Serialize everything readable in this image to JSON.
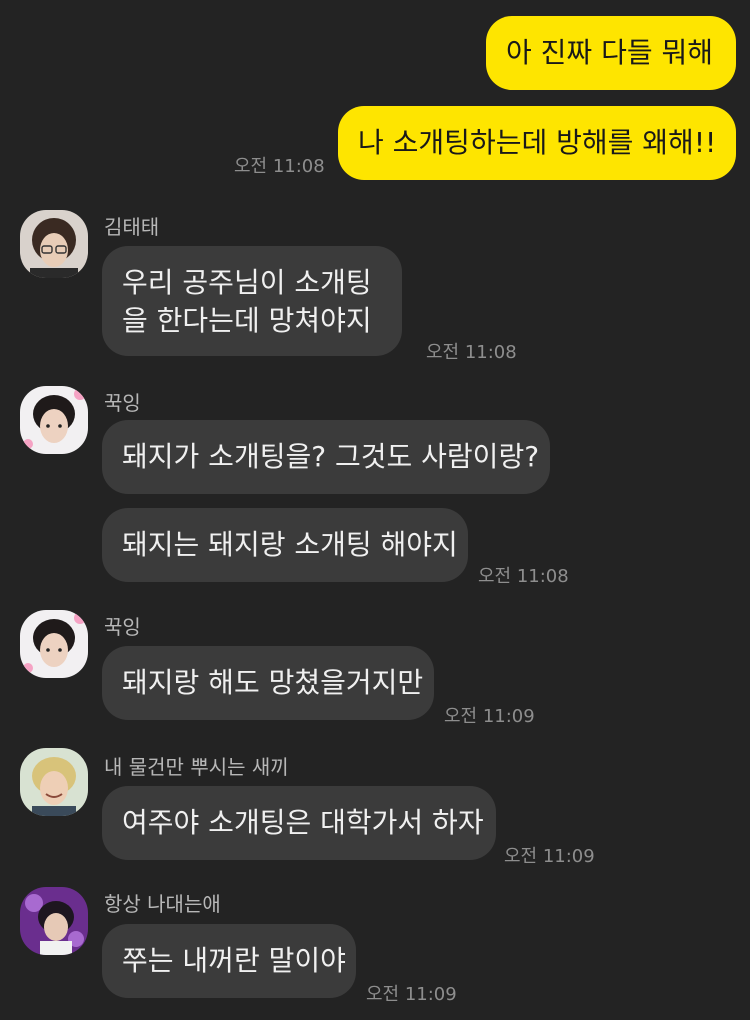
{
  "messages": {
    "out1": "아 진짜 다들 뭐해",
    "out2": "나 소개팅하는데 방해를 왜해!!",
    "out_time": "오전 11:08",
    "g1": {
      "sender": "김태태",
      "text": "우리 공주님이 소개팅을 한다는데 망쳐야지",
      "time": "오전 11:08"
    },
    "g2": {
      "sender": "꾹잉",
      "text1": "돼지가 소개팅을? 그것도 사람이랑?",
      "text2": "돼지는 돼지랑 소개팅 해야지",
      "time": "오전 11:08"
    },
    "g3": {
      "sender": "꾹잉",
      "text": "돼지랑 해도 망쳤을거지만",
      "time": "오전 11:09"
    },
    "g4": {
      "sender": "내 물건만 뿌시는 새끼",
      "text": "여주야 소개팅은 대학가서 하자",
      "time": "오전 11:09"
    },
    "g5": {
      "sender": "항상 나대는애",
      "text": "쭈는 내꺼란 말이야",
      "time": "오전 11:09"
    }
  },
  "colors": {
    "background": "#232323",
    "outgoing_bubble": "#fee500",
    "incoming_bubble": "#3b3b3b"
  }
}
